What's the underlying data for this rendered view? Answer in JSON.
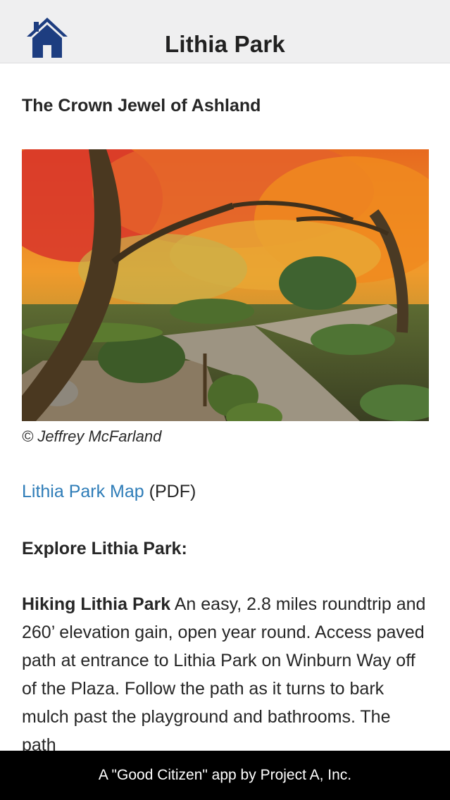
{
  "nav": {
    "title": "Lithia Park",
    "home_icon": "home-icon"
  },
  "content": {
    "subtitle": "The Crown Jewel of Ashland",
    "photo_credit": "© Jeffrey McFarland",
    "map_link_label": "Lithia Park Map",
    "map_link_suffix": " (PDF)",
    "explore_heading": "Explore Lithia Park:",
    "hiking_title": "Hiking Lithia Park",
    "hiking_text": " An easy, 2.8 miles roundtrip and 260’ elevation gain, open year round. Access paved path at entrance to Lithia Park on Winburn Way off of the Plaza. Follow the path as it turns to bark mulch past the playground and bathrooms. The path"
  },
  "footer": {
    "text": "A \"Good Citizen\" app by Project A, Inc."
  },
  "colors": {
    "link": "#2f7db8",
    "home_icon": "#1d3d80",
    "nav_bg": "#efeff0",
    "footer_bg": "#000000"
  }
}
